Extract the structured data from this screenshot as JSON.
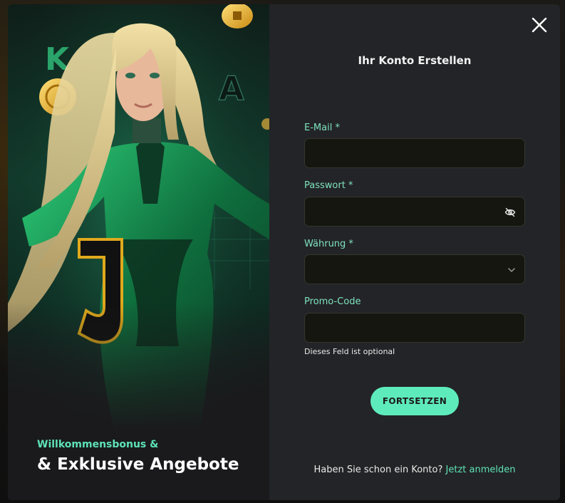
{
  "promo": {
    "subtitle": "Willkommensbonus &",
    "title": "& Exklusive Angebote",
    "art_letters": [
      "K",
      "A",
      "J"
    ]
  },
  "form": {
    "title": "Ihr Konto Erstellen",
    "fields": {
      "email": {
        "label": "E-Mail *",
        "value": ""
      },
      "password": {
        "label": "Passwort *",
        "value": "",
        "icon": "eye-off-icon"
      },
      "currency": {
        "label": "Währung *",
        "value": "",
        "icon": "chevron-down-icon"
      },
      "promo": {
        "label": "Promo-Code",
        "value": "",
        "hint": "Dieses Feld ist optional"
      }
    },
    "submit_label": "FORTSETZEN",
    "login_prompt": "Haben Sie schon ein Konto?",
    "login_link": "Jetzt anmelden"
  },
  "colors": {
    "accent": "#5eebbb",
    "label": "#7ee3bf",
    "panel": "#232427",
    "input_bg": "#15160f"
  }
}
